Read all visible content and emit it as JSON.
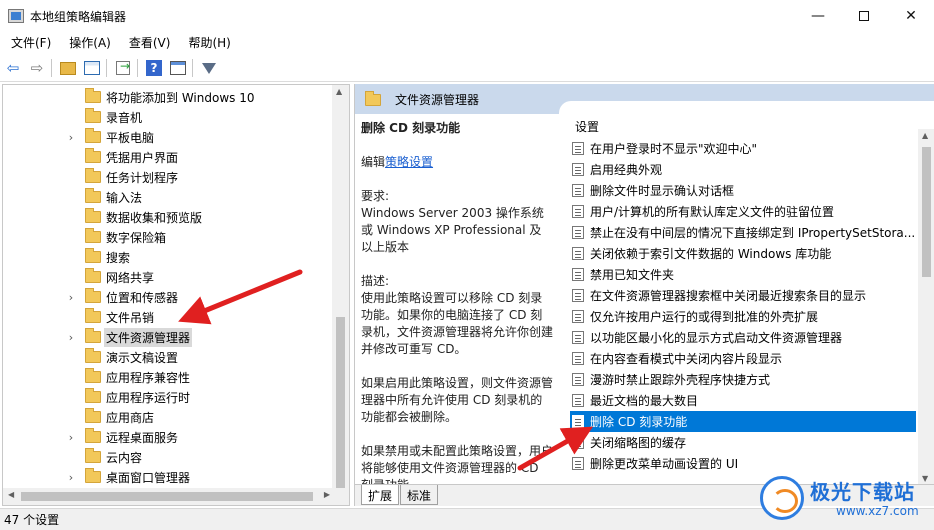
{
  "window": {
    "title": "本地组策略编辑器",
    "minimize": "—",
    "close": "✕"
  },
  "menu": [
    "文件(F)",
    "操作(A)",
    "查看(V)",
    "帮助(H)"
  ],
  "toolbar": {
    "icons": [
      "back-icon",
      "forward-icon",
      "folder-up-icon",
      "show-hide-tree-icon",
      "export-list-icon",
      "help-icon",
      "properties-icon",
      "filter-icon"
    ],
    "back": "⇦",
    "forward": "⇨",
    "help": "?"
  },
  "tree": {
    "items": [
      {
        "label": "将功能添加到 Windows 10",
        "expandable": false
      },
      {
        "label": "录音机",
        "expandable": false
      },
      {
        "label": "平板电脑",
        "expandable": true
      },
      {
        "label": "凭据用户界面",
        "expandable": false
      },
      {
        "label": "任务计划程序",
        "expandable": false
      },
      {
        "label": "输入法",
        "expandable": false
      },
      {
        "label": "数据收集和预览版",
        "expandable": false
      },
      {
        "label": "数字保险箱",
        "expandable": false
      },
      {
        "label": "搜索",
        "expandable": false
      },
      {
        "label": "网络共享",
        "expandable": false
      },
      {
        "label": "位置和传感器",
        "expandable": true
      },
      {
        "label": "文件吊销",
        "expandable": false
      },
      {
        "label": "文件资源管理器",
        "expandable": true,
        "selected": true
      },
      {
        "label": "演示文稿设置",
        "expandable": false
      },
      {
        "label": "应用程序兼容性",
        "expandable": false
      },
      {
        "label": "应用程序运行时",
        "expandable": false
      },
      {
        "label": "应用商店",
        "expandable": false
      },
      {
        "label": "远程桌面服务",
        "expandable": true
      },
      {
        "label": "云内容",
        "expandable": false
      },
      {
        "label": "桌面窗口管理器",
        "expandable": true
      }
    ],
    "expander": "›"
  },
  "right": {
    "header": "文件资源管理器",
    "description": {
      "title": "删除 CD 刻录功能",
      "edit_prefix": "编辑",
      "edit_link": "策略设置",
      "requirements_label": "要求:",
      "requirements_text": "Windows Server 2003 操作系统或 Windows XP Professional 及以上版本",
      "desc_label": "描述:",
      "desc_text": "使用此策略设置可以移除 CD 刻录功能。如果你的电脑连接了 CD 刻录机，文件资源管理器将允许你创建并修改可重写 CD。",
      "enabled_text": "如果启用此策略设置，则文件资源管理器中所有允许使用 CD 刻录机的功能都会被删除。",
      "disabled_text": "如果禁用或未配置此策略设置，用户将能够使用文件资源管理器的 CD 刻录功能。"
    },
    "list_header": "设置",
    "settings": [
      {
        "label": "在用户登录时不显示\"欢迎中心\""
      },
      {
        "label": "启用经典外观"
      },
      {
        "label": "删除文件时显示确认对话框"
      },
      {
        "label": "用户/计算机的所有默认库定义文件的驻留位置"
      },
      {
        "label": "禁止在没有中间层的情况下直接绑定到 IPropertySetStora..."
      },
      {
        "label": "关闭依赖于索引文件数据的 Windows 库功能"
      },
      {
        "label": "禁用已知文件夹"
      },
      {
        "label": "在文件资源管理器搜索框中关闭最近搜索条目的显示"
      },
      {
        "label": "仅允许按用户运行的或得到批准的外壳扩展"
      },
      {
        "label": "以功能区最小化的显示方式启动文件资源管理器"
      },
      {
        "label": "在内容查看模式中关闭内容片段显示"
      },
      {
        "label": "漫游时禁止跟踪外壳程序快捷方式"
      },
      {
        "label": "最近文档的最大数目"
      },
      {
        "label": "删除 CD 刻录功能",
        "selected": true
      },
      {
        "label": "关闭缩略图的缓存"
      },
      {
        "label": "删除更改菜单动画设置的 UI"
      }
    ],
    "tabs": [
      "扩展",
      "标准"
    ],
    "active_tab": 0
  },
  "status": "47 个设置",
  "watermark": {
    "text": "极光下载站",
    "url": "www.xz7.com"
  },
  "colors": {
    "selection": "#0078d7",
    "header_bg": "#cad9ec",
    "arrow": "#e02020",
    "link": "#1a5fd0"
  }
}
